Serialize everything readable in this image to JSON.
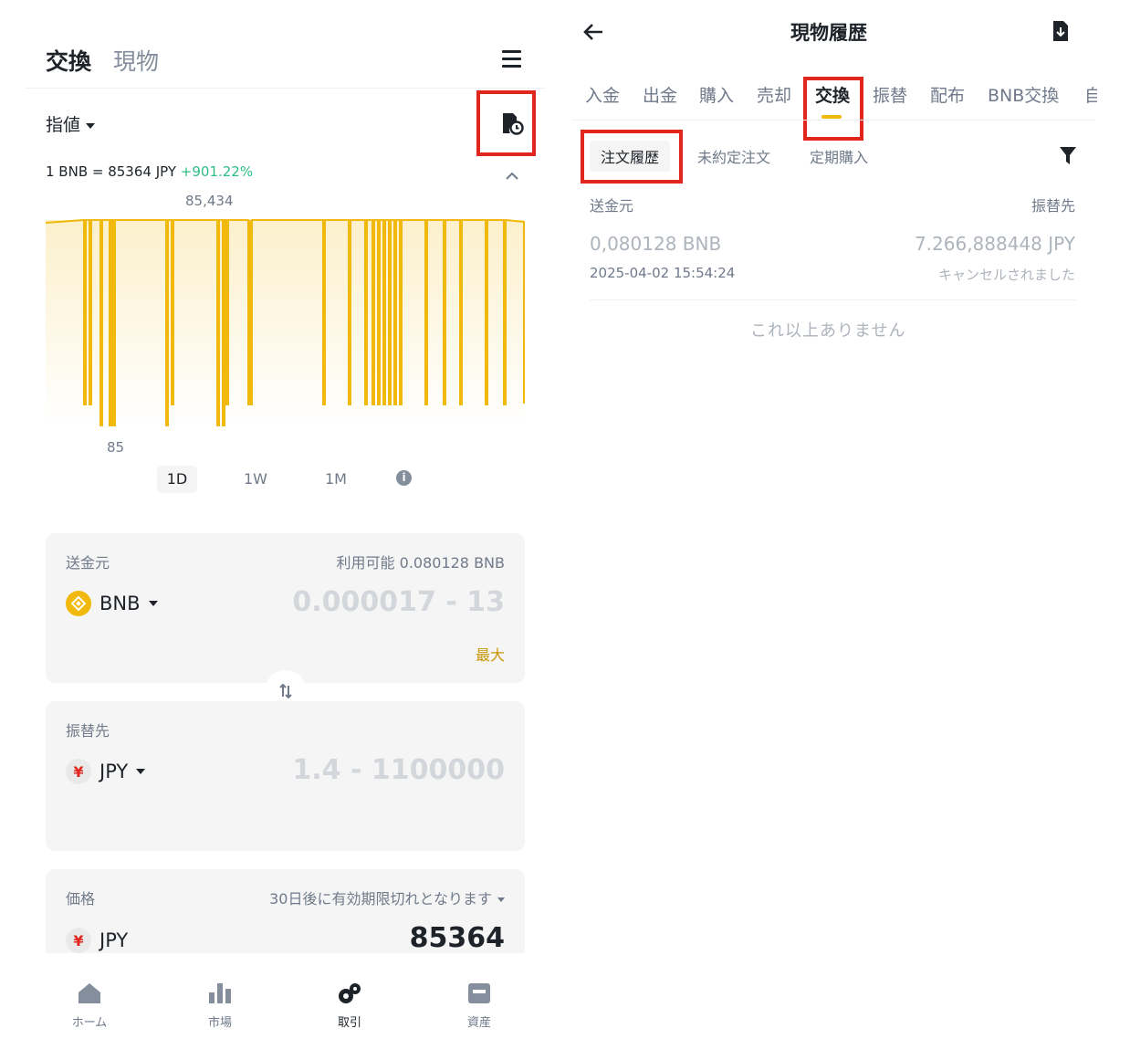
{
  "left": {
    "tabs": [
      "交換",
      "現物"
    ],
    "order_type": "指値",
    "rate": {
      "text": "1 BNB = 85364 JPY",
      "change": "+901.22%"
    },
    "chart_max_label": "85,434",
    "chart_min_label": "85",
    "ranges": [
      "1D",
      "1W",
      "1M"
    ],
    "from_card": {
      "label": "送金元",
      "available": "利用可能 0.080128 BNB",
      "coin": "BNB",
      "amount_placeholder": "0.000017 - 13",
      "max": "最大"
    },
    "to_card": {
      "label": "振替先",
      "coin": "JPY",
      "amount_placeholder": "1.4 - 1100000"
    },
    "price_card": {
      "label": "価格",
      "expiry": "30日後に有効期限切れとなります",
      "coin": "JPY",
      "value": "85364"
    },
    "nav": [
      "ホーム",
      "市場",
      "取引",
      "資産"
    ]
  },
  "right": {
    "title": "現物履歴",
    "tabs": [
      "入金",
      "出金",
      "購入",
      "売却",
      "交換",
      "振替",
      "配布",
      "BNB交換",
      "自"
    ],
    "subtabs": [
      "注文履歴",
      "未約定注文",
      "定期購入"
    ],
    "col_from": "送金元",
    "col_to": "振替先",
    "record": {
      "from_amount": "0,080128 BNB",
      "time": "2025-04-02 15:54:24",
      "to_amount": "7.266,888448 JPY",
      "status": "キャンセルされました"
    },
    "no_more": "これ以上ありません"
  },
  "colors": {
    "accent": "#f0b90b",
    "up": "#2ebd85",
    "highlight": "#e0261d"
  },
  "icons": [
    "menu-icon",
    "history-icon",
    "chevron-up-icon",
    "info-icon",
    "bnb-icon",
    "yen-icon",
    "swap-icon",
    "home-icon",
    "market-icon",
    "trade-icon",
    "wallet-icon",
    "back-arrow-icon",
    "download-icon",
    "filter-icon"
  ]
}
